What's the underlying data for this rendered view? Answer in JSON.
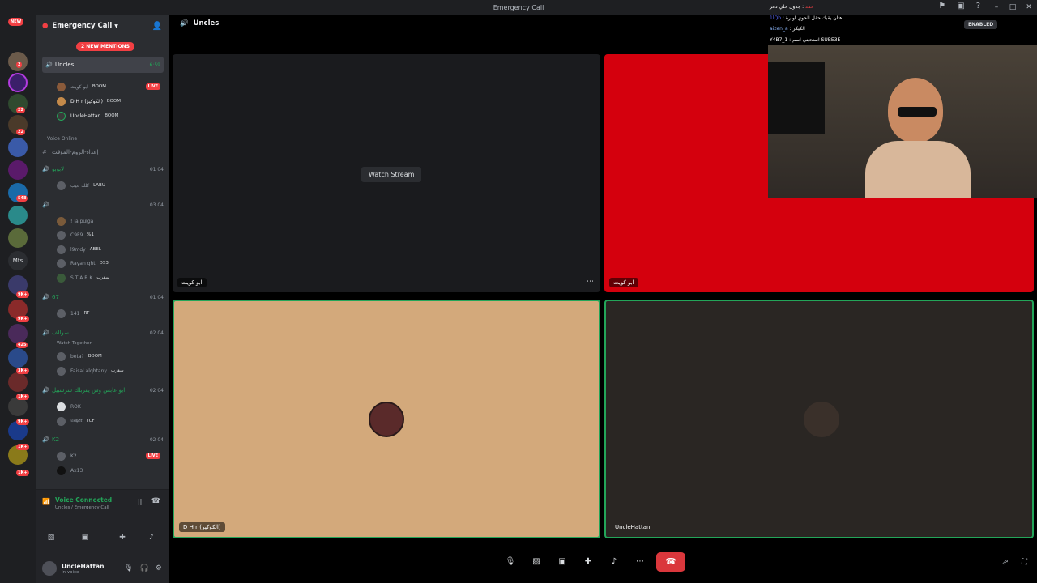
{
  "titlebar": {
    "title": "Emergency Call"
  },
  "sidebar": {
    "server_name": "Emergency Call",
    "mentions_badge": "2 NEW MENTIONS",
    "active_channel": {
      "name": "Uncles",
      "time": "6:59"
    },
    "uncles_users": [
      {
        "name": "ابو كويت",
        "tag": "BOOM",
        "live": "LIVE"
      },
      {
        "name": "D H r (الكوكيز)",
        "tag": "BOOM"
      },
      {
        "name": "UncleHattan",
        "tag": "BOOM"
      }
    ],
    "category": "Voice Online",
    "text_channel": "إعداد-الروم-المؤقت",
    "channels": [
      {
        "name": "لابوبو",
        "count": "01  04",
        "users": [
          {
            "name": "كلك عيب",
            "tag": "LABU"
          }
        ]
      },
      {
        "name": ".",
        "count": "03  04",
        "users": [
          {
            "name": "! la pulga",
            "tag": ""
          },
          {
            "name": "C9F9",
            "tag": "%1"
          },
          {
            "name": "l9mdy",
            "tag": "ABEL"
          },
          {
            "name": "Rayan qht",
            "tag": "DS3"
          },
          {
            "name": "S T A R K",
            "tag": "سقرب"
          }
        ]
      },
      {
        "name": "67",
        "count": "01  04",
        "users": [
          {
            "name": "141",
            "tag": "RT"
          }
        ]
      },
      {
        "name": "سوالف",
        "count": "02  04",
        "note": "Watch Together",
        "users": [
          {
            "name": "beta?",
            "tag": "BOOM"
          },
          {
            "name": "Faisal alqhtany",
            "tag": "سقرب"
          }
        ]
      },
      {
        "name": "ابو عابس وش يقربلك شرشبيل",
        "count": "02  04",
        "users": [
          {
            "name": "ROK",
            "tag": ""
          },
          {
            "name": "𝕾𝖆𝖇𝖊𝖗",
            "tag": "TCF"
          }
        ]
      },
      {
        "name": "K2",
        "count": "02  04",
        "users": [
          {
            "name": "K2",
            "tag": "",
            "live": "LIVE"
          },
          {
            "name": "Ax13",
            "tag": ""
          }
        ]
      }
    ],
    "voice": {
      "status": "Voice Connected",
      "location": "Uncles / Emergency Call"
    },
    "user": {
      "name": "UncleHattan",
      "status": "In voice"
    }
  },
  "main": {
    "channel": "Uncles",
    "watch_stream": "Watch Stream",
    "tiles": [
      {
        "label": "ابو كويت",
        "color": "#1a1b1e"
      },
      {
        "label": "ابو كويت",
        "color": "#d4000d"
      },
      {
        "label": "D H r (الكوكيز)",
        "color": "#d3a97b"
      },
      {
        "label": "UncleHattan",
        "color": "#2a2623"
      }
    ]
  },
  "overlay": {
    "chat": [
      {
        "user": "حمد",
        "text": "جدول حلي دعر"
      },
      {
        "user": "1lQb",
        "text": "هتان يقبك حقل الحوي اوبرة"
      },
      {
        "user": "aizen_a",
        "text": "الكيكز"
      },
      {
        "user": "Y4B7_1",
        "text": "استحيني اسم SUBE3E"
      }
    ],
    "enabled": "ENABLED"
  },
  "server_badges": [
    "NEW",
    "2",
    "22",
    "22",
    "548",
    "9K+",
    "9K+",
    "425",
    "3K+",
    "1K+",
    "9K+",
    "1K+",
    "1K+"
  ],
  "colors": {
    "accent_green": "#23a559",
    "danger": "#da373c",
    "brand": "#5865f2"
  }
}
